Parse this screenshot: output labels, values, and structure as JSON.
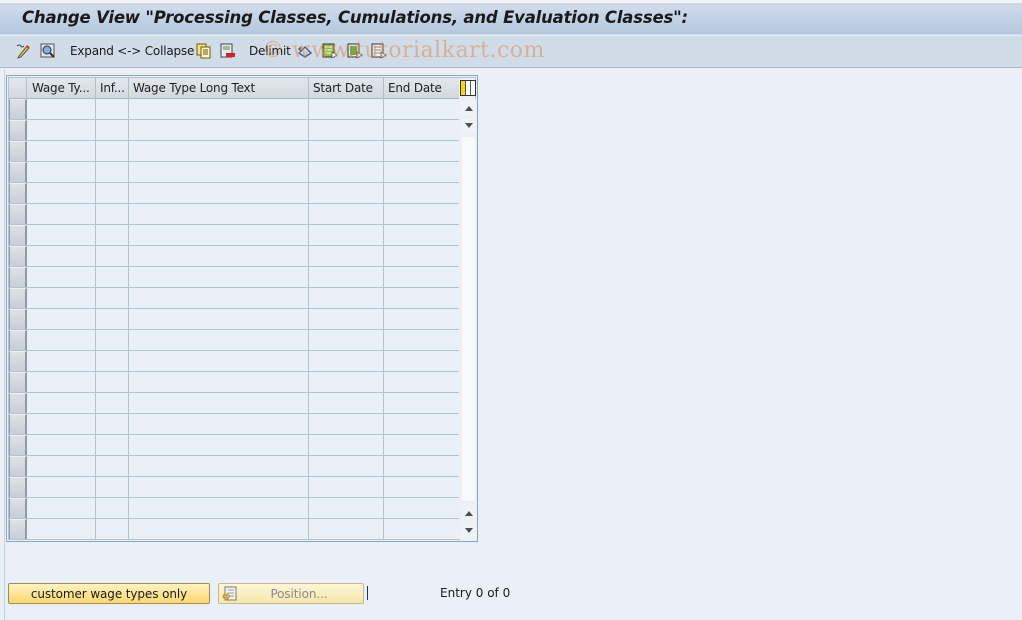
{
  "window": {
    "title": "Change View \"Processing Classes, Cumulations, and Evaluation Classes\":"
  },
  "toolbar": {
    "items": [
      {
        "icon": "display-change-icon"
      },
      {
        "icon": "find-icon"
      },
      {
        "label": "Expand <-> Collapse"
      },
      {
        "icon": "copy-as-icon"
      },
      {
        "icon": "delete-icon"
      },
      {
        "label": "Delimit"
      },
      {
        "icon": "undo-change-icon"
      },
      {
        "icon": "select-all-icon"
      },
      {
        "icon": "select-block-icon"
      },
      {
        "icon": "deselect-all-icon"
      }
    ]
  },
  "watermark": "© www.tutorialkart.com",
  "table": {
    "columns": [
      {
        "label": "Wage Ty..."
      },
      {
        "label": "Inf..."
      },
      {
        "label": "Wage Type Long Text"
      },
      {
        "label": "Start Date"
      },
      {
        "label": "End Date"
      }
    ],
    "rows": [
      [
        "",
        "",
        "",
        "",
        ""
      ],
      [
        "",
        "",
        "",
        "",
        ""
      ],
      [
        "",
        "",
        "",
        "",
        ""
      ],
      [
        "",
        "",
        "",
        "",
        ""
      ],
      [
        "",
        "",
        "",
        "",
        ""
      ],
      [
        "",
        "",
        "",
        "",
        ""
      ],
      [
        "",
        "",
        "",
        "",
        ""
      ],
      [
        "",
        "",
        "",
        "",
        ""
      ],
      [
        "",
        "",
        "",
        "",
        ""
      ],
      [
        "",
        "",
        "",
        "",
        ""
      ],
      [
        "",
        "",
        "",
        "",
        ""
      ],
      [
        "",
        "",
        "",
        "",
        ""
      ],
      [
        "",
        "",
        "",
        "",
        ""
      ],
      [
        "",
        "",
        "",
        "",
        ""
      ],
      [
        "",
        "",
        "",
        "",
        ""
      ],
      [
        "",
        "",
        "",
        "",
        ""
      ],
      [
        "",
        "",
        "",
        "",
        ""
      ],
      [
        "",
        "",
        "",
        "",
        ""
      ],
      [
        "",
        "",
        "",
        "",
        ""
      ],
      [
        "",
        "",
        "",
        "",
        ""
      ],
      [
        "",
        "",
        "",
        "",
        ""
      ]
    ]
  },
  "footer": {
    "customer_button": "customer wage types only",
    "position_button": "Position...",
    "entry_text": "Entry 0 of 0"
  },
  "colors": {
    "button_yellow": "#fcd86f",
    "background": "#e9f0f8",
    "title_bar": "#b4c8de"
  }
}
